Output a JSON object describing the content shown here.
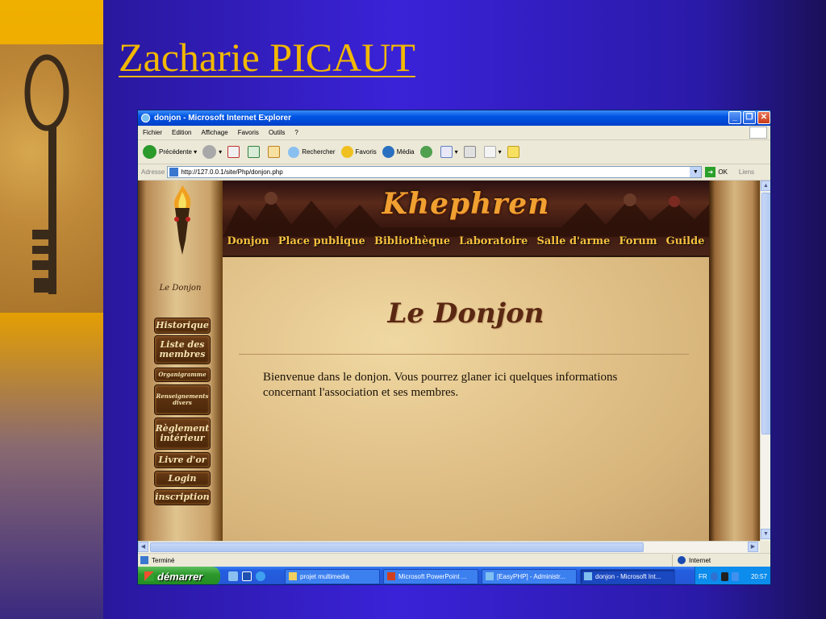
{
  "slide": {
    "title": "Zacharie PICAUT"
  },
  "browser": {
    "window_title": "donjon - Microsoft Internet Explorer",
    "menu": [
      "Fichier",
      "Edition",
      "Affichage",
      "Favoris",
      "Outils",
      "?"
    ],
    "toolbar": {
      "back": "Précédente",
      "search": "Rechercher",
      "favorites": "Favoris",
      "media": "Média"
    },
    "address": {
      "label": "Adresse",
      "url": "http://127.0.0.1/site/Php/donjon.php",
      "go": "OK",
      "links": "Liens"
    },
    "status": {
      "text": "Terminé",
      "zone": "Internet"
    }
  },
  "page": {
    "banner_title": "Khephren",
    "banner_nav": [
      "Donjon",
      "Place publique",
      "Bibliothèque",
      "Laboratoire",
      "Salle d'arme",
      "Forum",
      "Guilde"
    ],
    "sidebar_heading": "Le Donjon",
    "sidebar_buttons": [
      "Historique",
      "Liste des membres",
      "Organigramme",
      "Renseignements divers",
      "Règlement intérieur",
      "Livre d'or",
      "Login",
      "inscription"
    ],
    "content_title": "Le Donjon",
    "content_text": "Bienvenue dans le donjon. Vous pourrez glaner ici quelques informations concernant l'association et ses membres."
  },
  "taskbar": {
    "start": "démarrer",
    "tasks": [
      "projet multimedia",
      "Microsoft PowerPoint ...",
      "[EasyPHP] - Administr...",
      "donjon - Microsoft Int..."
    ],
    "tray_lang": "FR",
    "clock": "20:57"
  },
  "colors": {
    "slide_title": "#f2b800",
    "slide_background": "#3a22d8",
    "banner_text": "#f0a030"
  }
}
